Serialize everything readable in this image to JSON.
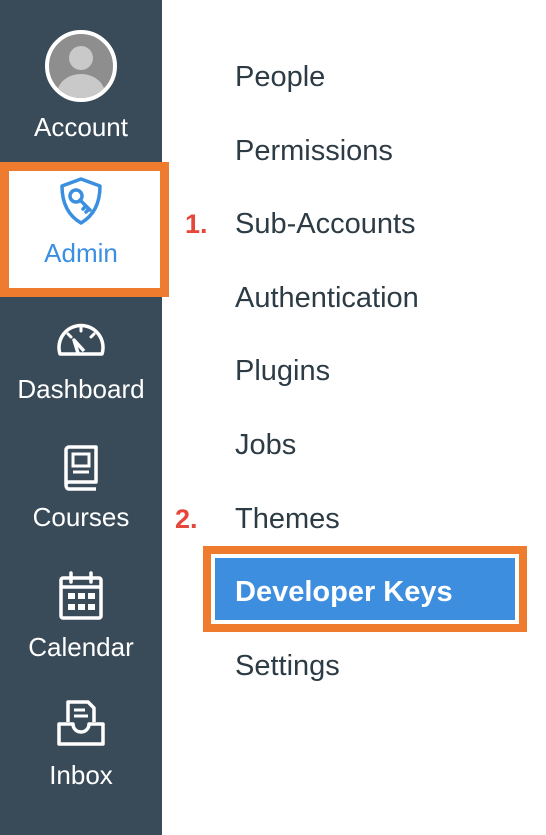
{
  "sidebar": {
    "items": [
      {
        "label": "Account",
        "icon": "avatar"
      },
      {
        "label": "Admin",
        "icon": "shield-key-icon",
        "active": true
      },
      {
        "label": "Dashboard",
        "icon": "speedometer-icon"
      },
      {
        "label": "Courses",
        "icon": "book-icon"
      },
      {
        "label": "Calendar",
        "icon": "calendar-icon"
      },
      {
        "label": "Inbox",
        "icon": "inbox-icon"
      }
    ]
  },
  "menu": {
    "items": [
      {
        "label": "People"
      },
      {
        "label": "Permissions"
      },
      {
        "label": "Sub-Accounts",
        "step": "1."
      },
      {
        "label": "Authentication"
      },
      {
        "label": "Plugins"
      },
      {
        "label": "Jobs"
      },
      {
        "label": "Themes",
        "step": "2."
      },
      {
        "label": "Developer Keys",
        "selected": true
      },
      {
        "label": "Settings"
      }
    ]
  },
  "colors": {
    "sidebar_bg": "#394b58",
    "active_blue": "#3b8fe0",
    "highlight_orange": "#ef7b2e",
    "step_red": "#e5473a",
    "text_dark": "#2d3b45"
  }
}
